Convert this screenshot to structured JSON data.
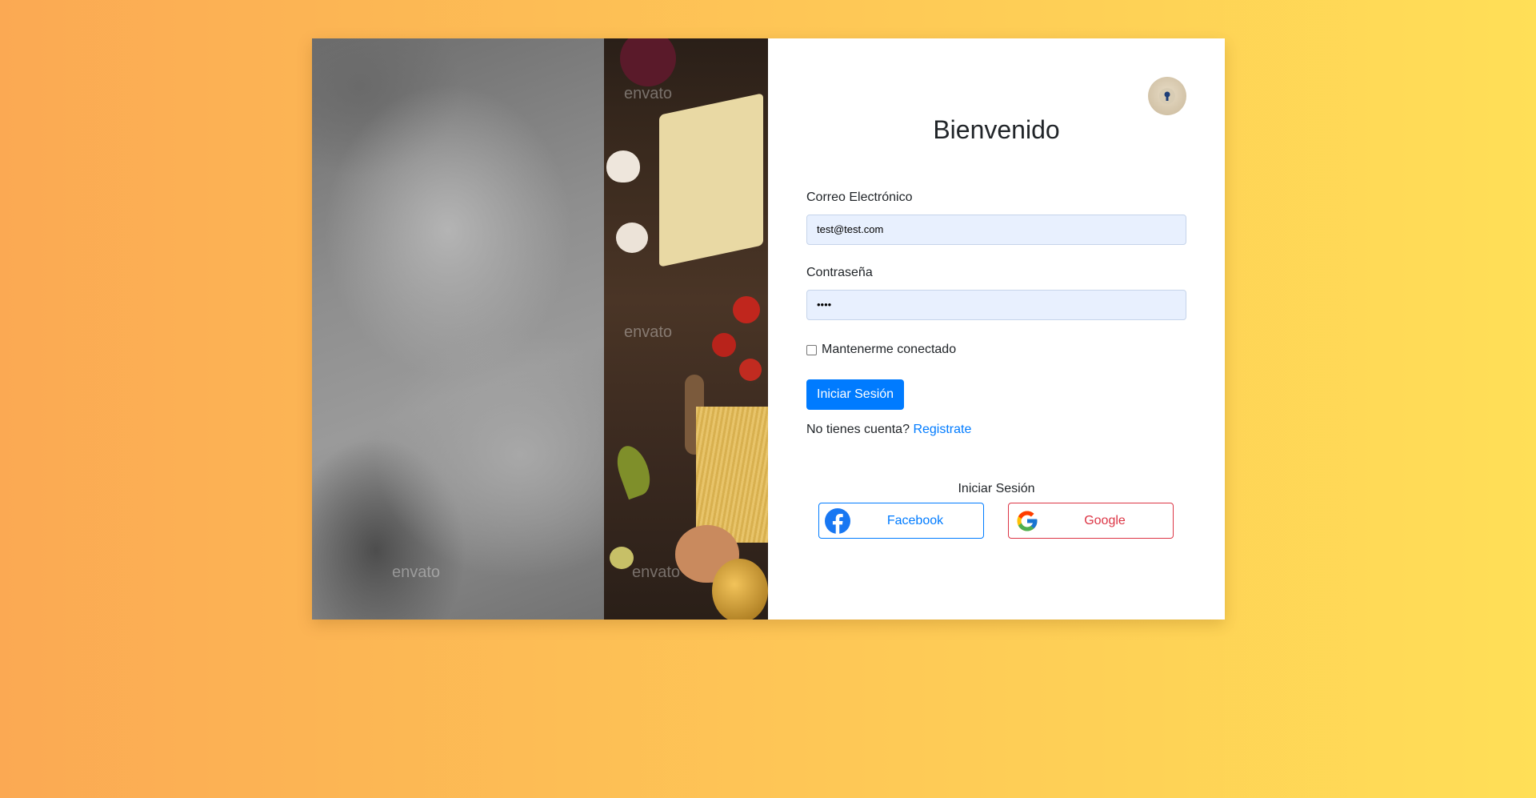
{
  "photo": {
    "watermarks": [
      "envato",
      "envato",
      "envato",
      "envato"
    ]
  },
  "login": {
    "title": "Bienvenido",
    "email_label": "Correo Electrónico",
    "email_value": "test@test.com",
    "password_label": "Contraseña",
    "password_value": "••••",
    "remember_label": "Mantenerme conectado",
    "remember_checked": false,
    "submit_label": "Iniciar Sesión",
    "register_prompt": "No tienes cuenta?",
    "register_link": "Registrate",
    "social_title": "Iniciar Sesión",
    "facebook_label": "Facebook",
    "google_label": "Google",
    "avatar_icon": "keyhole-icon"
  },
  "colors": {
    "primary": "#007bff",
    "danger": "#dc3545",
    "input_bg": "#e8f0fe",
    "background_start": "#fba953",
    "background_end": "#ffdf57"
  }
}
